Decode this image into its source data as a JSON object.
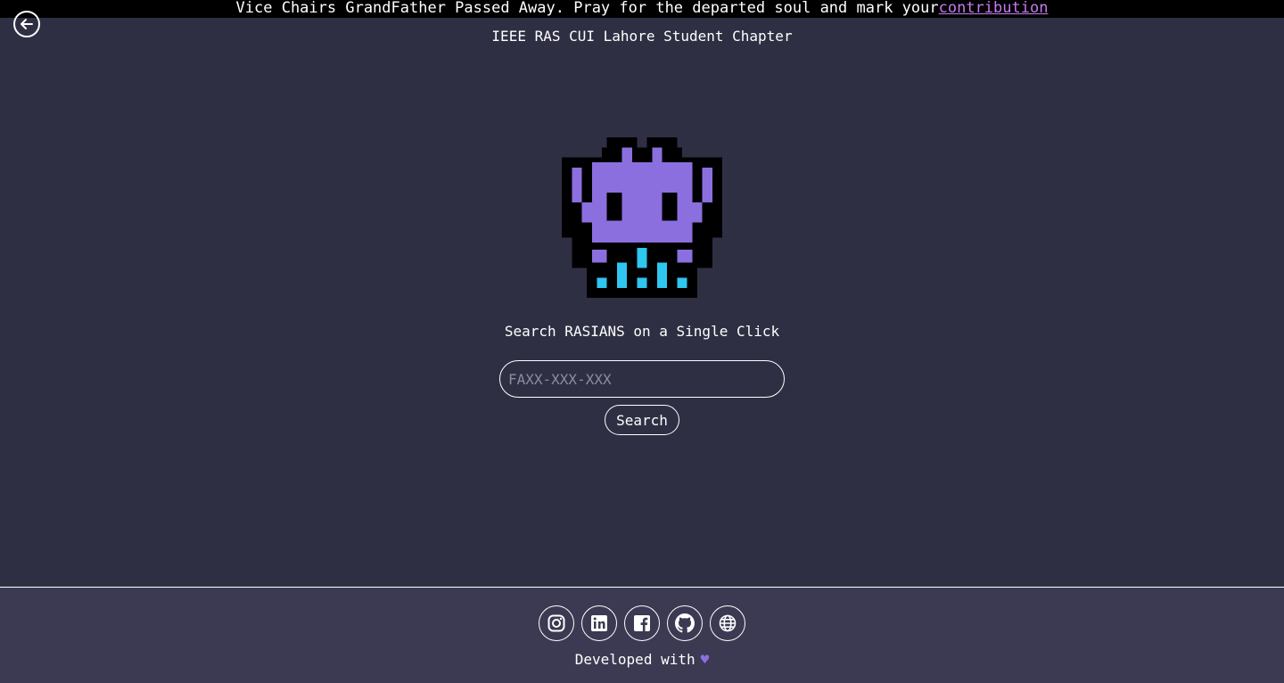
{
  "banner": {
    "message": "Vice Chairs GrandFather Passed Away. Pray for the departed soul and mark your",
    "link_text": "contribution"
  },
  "header": {
    "back_icon": "arrow-left-circle-icon",
    "chapter_name": "IEEE RAS CUI Lahore Student Chapter"
  },
  "main": {
    "mascot_icon": "pixel-alien-icon",
    "tagline": "Search RASIANS on a Single Click",
    "search": {
      "placeholder": "FAXX-XXX-XXX",
      "value": "",
      "button_label": "Search"
    }
  },
  "footer": {
    "social": [
      {
        "icon": "instagram-icon"
      },
      {
        "icon": "linkedin-icon"
      },
      {
        "icon": "facebook-icon"
      },
      {
        "icon": "github-icon"
      },
      {
        "icon": "globe-icon"
      }
    ],
    "developed_text": "Developed with",
    "heart_icon": "heart-icon"
  },
  "colors": {
    "background": "#2f2f44",
    "footer_background": "#3b3a52",
    "banner_background": "#000000",
    "link": "#c57cf0",
    "mascot_purple": "#8b6fdf",
    "mascot_cyan": "#2fc6f0",
    "heart": "#8b6fdf"
  }
}
